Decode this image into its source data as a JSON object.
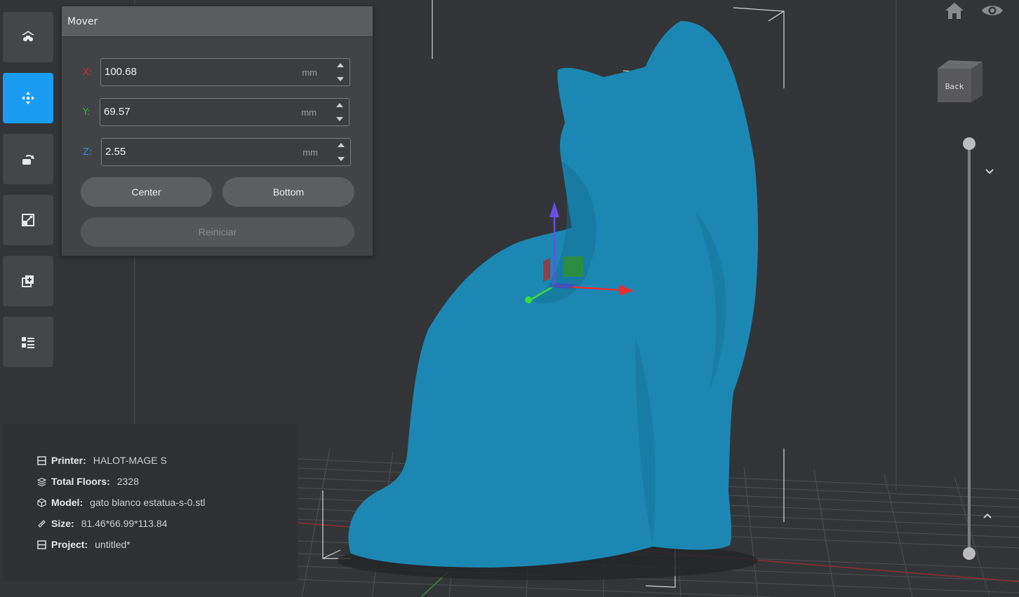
{
  "move_panel": {
    "title": "Mover",
    "x": {
      "label": "X:",
      "value": "100.68",
      "unit": "mm",
      "color": "#d23030"
    },
    "y": {
      "label": "Y:",
      "value": "69.57",
      "unit": "mm",
      "color": "#3ab53a"
    },
    "z": {
      "label": "Z:",
      "value": "2.55",
      "unit": "mm",
      "color": "#3a8bd8"
    },
    "center_label": "Center",
    "bottom_label": "Bottom",
    "reset_label": "Reiniciar"
  },
  "info": {
    "printer_key": "Printer:",
    "printer_val": "HALOT-MAGE S",
    "floors_key": "Total Floors:",
    "floors_val": "2328",
    "model_key": "Model:",
    "model_val": "gato blanco estatua-s-0.stl",
    "size_key": "Size:",
    "size_val": "81.46*66.99*113.84",
    "project_key": "Project:",
    "project_val": "untitled*"
  },
  "view_cube": {
    "face_label": "Back"
  },
  "colors": {
    "model": "#1c87b3",
    "accent": "#1a9cf3",
    "background": "#333437"
  },
  "toolbar": {
    "tools": [
      "home-layout-icon",
      "move-icon",
      "rotate-icon",
      "scale-icon",
      "add-copy-icon",
      "list-icon"
    ],
    "active": "move-icon"
  }
}
